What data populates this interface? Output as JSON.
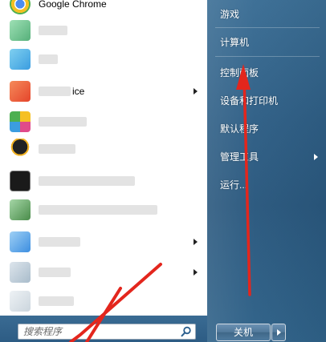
{
  "programs": [
    {
      "label": "Google Chrome",
      "visible_label": "Google Chrome",
      "icon": "chrome-icon",
      "color": "#3b8de0",
      "has_arrow": false
    },
    {
      "label": "",
      "icon": "blurred-app-icon-1",
      "color": "#5cc08a",
      "has_arrow": false
    },
    {
      "label": "",
      "icon": "blurred-app-icon-2",
      "color": "#4fb3e6",
      "has_arrow": false
    },
    {
      "label": "ice",
      "icon": "blurred-app-icon-3",
      "color": "#f06a3a",
      "has_arrow": true
    },
    {
      "label": "",
      "icon": "blurred-app-icon-4",
      "color": "#58c3e8",
      "has_arrow": false
    },
    {
      "label": "",
      "icon": "qq-penguin-icon",
      "color": "#2a2a2a",
      "has_arrow": false
    },
    {
      "label": "",
      "icon": "cmd-icon",
      "color": "#1e1e1e",
      "has_arrow": false
    },
    {
      "label": "",
      "icon": "blurred-app-icon-5",
      "color": "#6aa86a",
      "has_arrow": false
    },
    {
      "label": "",
      "icon": "blurred-app-icon-6",
      "color": "#6bb0e8",
      "has_arrow": true
    },
    {
      "label": "",
      "icon": "blurred-app-icon-7",
      "color": "#b9c9d6",
      "has_arrow": true
    },
    {
      "label": "",
      "icon": "blurred-app-icon-8",
      "color": "#cfd8df",
      "has_arrow": false
    }
  ],
  "right_menu": [
    {
      "label": "游戏",
      "has_arrow": false
    },
    {
      "label": "计算机",
      "has_arrow": false
    },
    {
      "label": "控制面板",
      "has_arrow": false
    },
    {
      "label": "设备和打印机",
      "has_arrow": false
    },
    {
      "label": "默认程序",
      "has_arrow": false
    },
    {
      "label": "管理工具",
      "has_arrow": true
    },
    {
      "label": "运行...",
      "has_arrow": false
    }
  ],
  "search": {
    "placeholder": "搜索程序"
  },
  "shutdown": {
    "label": "关机"
  },
  "colors": {
    "annotation_arrow": "#e3261d",
    "right_panel": "#2f5f86"
  }
}
